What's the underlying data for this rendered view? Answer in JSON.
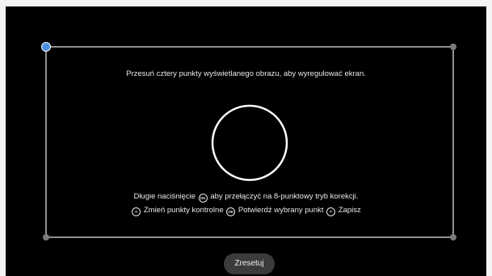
{
  "instruction": "Przesuń cztery punkty wyświetlanego obrazu, aby wyregulować ekran.",
  "help": {
    "line1_pre": "Długie naciśnięcie",
    "line1_post": "aby przełączyć na 8-punktowy tryb korekcji.",
    "line2_change": "Zmień punkty kontrolne",
    "line2_confirm": "Potwierdź wybrany punkt",
    "line2_save": "Zapisz",
    "ok_glyph": "OK"
  },
  "reset_button": {
    "label": "Zresetuj"
  },
  "colors": {
    "background": "#000000",
    "frame_line": "#bfbfbf",
    "active_point": "#4a90e2",
    "inactive_point": "#7a7a7a",
    "circle": "#ffffff"
  },
  "icons": {
    "ok": "ok-button-icon",
    "change": "navigate-icon",
    "save": "back-save-icon"
  }
}
